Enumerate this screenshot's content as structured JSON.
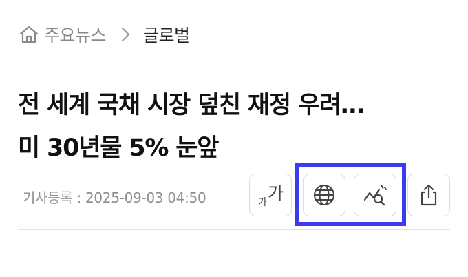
{
  "breadcrumb": {
    "home_label": "주요뉴스",
    "current_label": "글로벌"
  },
  "article": {
    "title_line1": "전 세계 국채 시장 덮친 재정 우려…",
    "title_line2": "미 30년물 5% 눈앞",
    "date_text": "기사등록 : 2025-09-03 04:50"
  },
  "tools": {
    "font_small_glyph": "가",
    "font_large_glyph": "가"
  },
  "icons": {
    "home": "home-icon",
    "separator": "chevron-right-icon",
    "translate": "globe-icon",
    "analyze": "chart-search-icon",
    "share": "share-icon"
  },
  "colors": {
    "highlight": "#3b3bf2",
    "muted_text": "#8a8a8a",
    "title_text": "#111111",
    "button_border": "#dcdcdc"
  }
}
